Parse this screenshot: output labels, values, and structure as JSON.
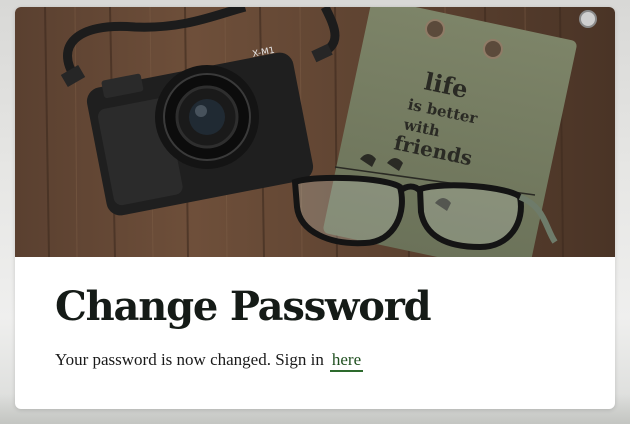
{
  "hero": {
    "notepad_lettering": "life is better with friends",
    "camera_badge": "X-M1"
  },
  "form": {
    "title": "Change Password",
    "message": "Your password is now changed. Sign in",
    "link_label": "here"
  },
  "colors": {
    "link": "#1f4f1f",
    "link_underline": "#2d6a2d",
    "title": "#151b17",
    "card_background": "#ffffff"
  }
}
